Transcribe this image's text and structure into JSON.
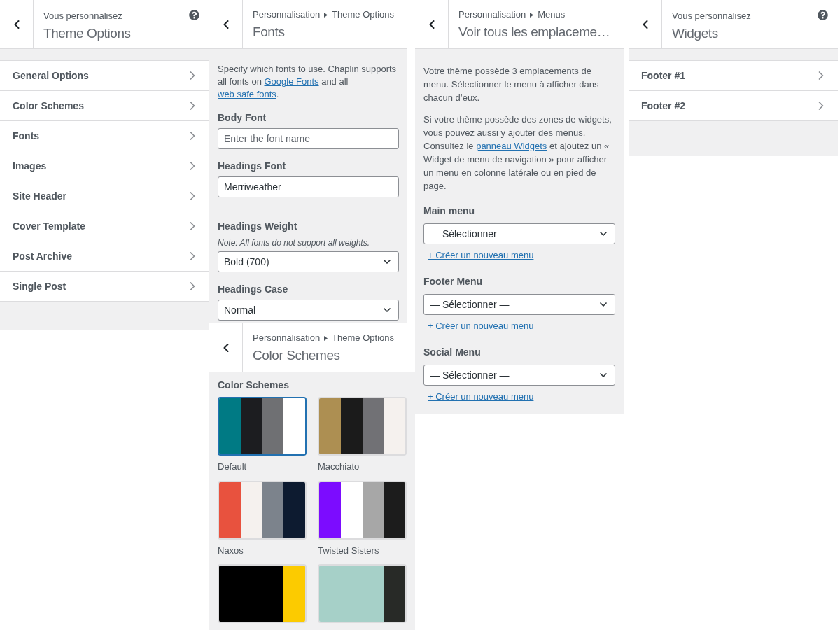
{
  "theme_options_panel": {
    "header": {
      "eyebrow": "Vous personnalisez",
      "title": "Theme Options",
      "help": true
    },
    "items": [
      {
        "label": "General Options"
      },
      {
        "label": "Color Schemes"
      },
      {
        "label": "Fonts"
      },
      {
        "label": "Images"
      },
      {
        "label": "Site Header"
      },
      {
        "label": "Cover Template"
      },
      {
        "label": "Post Archive"
      },
      {
        "label": "Single Post"
      }
    ]
  },
  "fonts_panel": {
    "header": {
      "breadcrumb": [
        "Personnalisation",
        "Theme Options"
      ],
      "title": "Fonts"
    },
    "description": [
      {
        "kind": "text",
        "text": "Specify which fonts to use. Chaplin supports all fonts on "
      },
      {
        "kind": "link",
        "text": "Google Fonts"
      },
      {
        "kind": "text",
        "text": " and all "
      },
      {
        "kind": "link",
        "text": "web safe fonts"
      },
      {
        "kind": "text",
        "text": "."
      }
    ],
    "fields": [
      {
        "kind": "input",
        "label": "Body Font",
        "placeholder": "Enter the font name"
      },
      {
        "kind": "input",
        "label": "Headings Font",
        "value": "Merriweather"
      },
      {
        "kind": "divider"
      },
      {
        "kind": "select",
        "label": "Headings Weight",
        "note": "Note: All fonts do not support all weights.",
        "value": "Bold (700)"
      },
      {
        "kind": "select",
        "label": "Headings Case",
        "value": "Normal"
      }
    ]
  },
  "color_schemes_panel": {
    "header": {
      "breadcrumb": [
        "Personnalisation",
        "Theme Options"
      ],
      "title": "Color Schemes"
    },
    "label": "Color Schemes",
    "schemes": [
      {
        "name": "Default",
        "selected": true,
        "stripes": [
          {
            "color": "#007a84"
          },
          {
            "color": "#1c1d20"
          },
          {
            "color": "#6f7073"
          },
          {
            "color": "#ffffff"
          }
        ]
      },
      {
        "name": "Macchiato",
        "selected": false,
        "stripes": [
          {
            "color": "#ad8f52"
          },
          {
            "color": "#1b1b1b"
          },
          {
            "color": "#717175"
          },
          {
            "color": "#f5f1ee"
          }
        ]
      },
      {
        "name": "Naxos",
        "selected": false,
        "stripes": [
          {
            "color": "#e8523e"
          },
          {
            "color": "#f5f1ee"
          },
          {
            "color": "#7c838c"
          },
          {
            "color": "#0d1b30"
          }
        ]
      },
      {
        "name": "Twisted Sisters",
        "selected": false,
        "stripes": [
          {
            "color": "#7c0cff"
          },
          {
            "color": "#ffffff"
          },
          {
            "color": "#a7a7a7"
          },
          {
            "color": "#1c1c1c"
          }
        ]
      },
      {
        "selected": false,
        "stripes": [
          {
            "color": "#000000"
          },
          {
            "color": "#000000"
          },
          {
            "color": "#000000"
          },
          {
            "color": "#fccb00"
          }
        ]
      },
      {
        "selected": false,
        "stripes": [
          {
            "color": "#a6d0c8"
          },
          {
            "color": "#a6d0c8"
          },
          {
            "color": "#a6d0c8"
          },
          {
            "color": "#282a27"
          }
        ]
      }
    ]
  },
  "menus_panel": {
    "header": {
      "breadcrumb": [
        "Personnalisation",
        "Menus"
      ],
      "title": "Voir tous les emplaceme…"
    },
    "intro": "Votre thème possède 3 emplacements de menu. Sélectionner le menu à afficher dans chacun d’eux.",
    "widgets_note": [
      {
        "kind": "text",
        "text": "Si votre thème possède des zones de widgets, vous pouvez aussi y ajouter des menus. Consultez le "
      },
      {
        "kind": "link",
        "text": "panneau Widgets"
      },
      {
        "kind": "text",
        "text": " et ajoutez un « Widget de menu de navigation » pour afficher un menu en colonne latérale ou en pied de page."
      }
    ],
    "locations": [
      {
        "label": "Main menu",
        "value": "— Sélectionner —",
        "create_link": "+ Créer un nouveau menu"
      },
      {
        "label": "Footer Menu",
        "value": "— Sélectionner —",
        "create_link": "+ Créer un nouveau menu"
      },
      {
        "label": "Social Menu",
        "value": "— Sélectionner —",
        "create_link": "+ Créer un nouveau menu"
      }
    ]
  },
  "widgets_panel": {
    "header": {
      "eyebrow": "Vous personnalisez",
      "title": "Widgets",
      "help": true
    },
    "items": [
      {
        "label": "Footer #1"
      },
      {
        "label": "Footer #2"
      }
    ]
  }
}
